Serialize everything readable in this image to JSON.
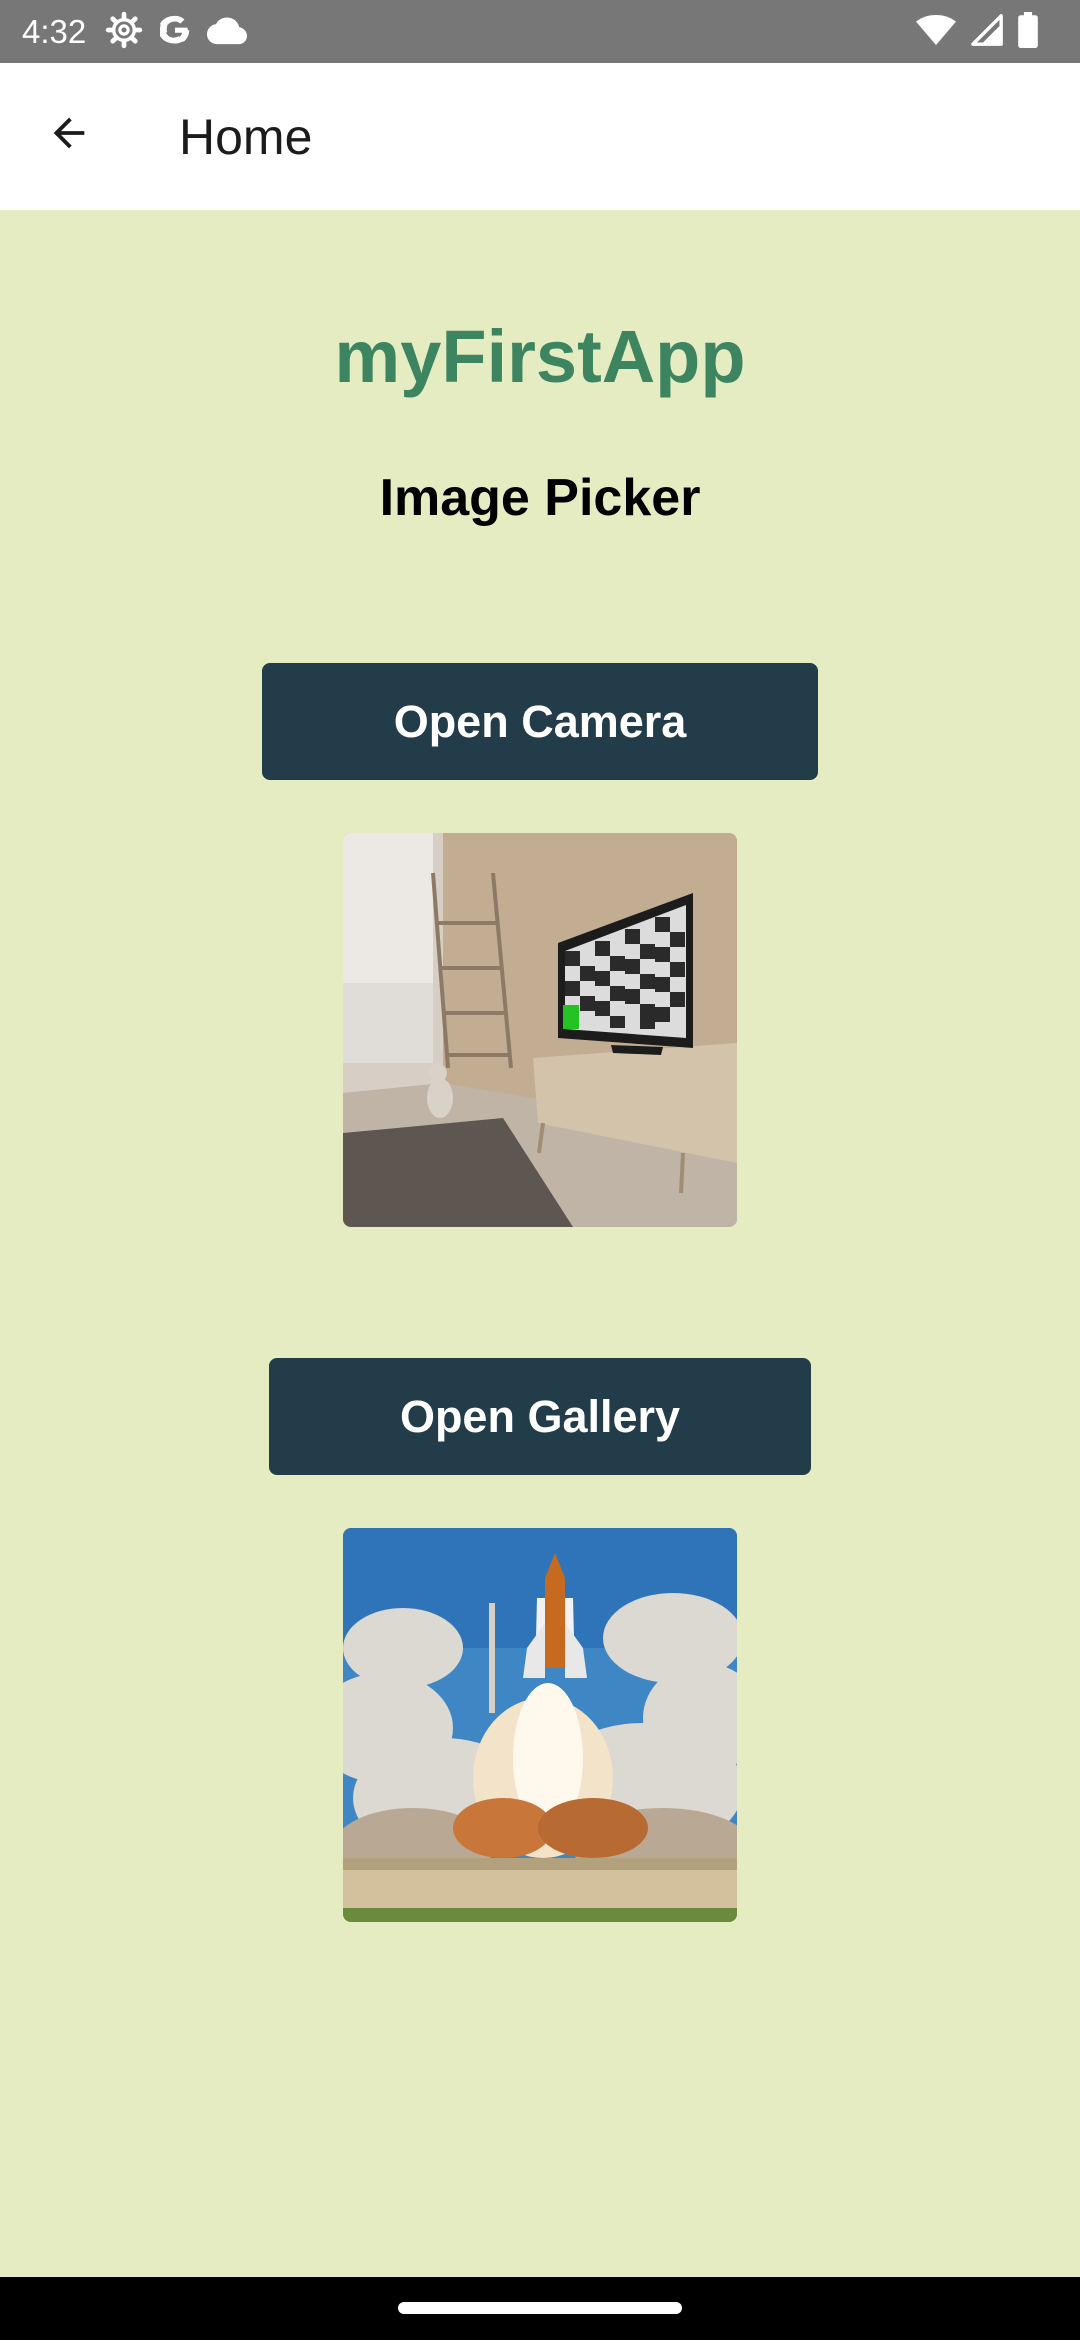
{
  "status_bar": {
    "time": "4:32",
    "left_icons": [
      "settings-icon",
      "google-icon",
      "cloud-icon"
    ],
    "right_icons": [
      "wifi-icon",
      "signal-icon",
      "battery-icon"
    ]
  },
  "app_bar": {
    "title": "Home",
    "back_icon": "arrow-back-icon"
  },
  "content": {
    "brand": "myFirstApp",
    "section_title": "Image Picker",
    "camera_button_label": "Open Camera",
    "gallery_button_label": "Open Gallery",
    "camera_image": "room-with-cat-and-tv-image",
    "gallery_image": "shuttle-launch-image"
  },
  "colors": {
    "background": "#e6ecc1",
    "brand": "#3d8560",
    "button": "#223c49",
    "status_bar": "#777777"
  }
}
